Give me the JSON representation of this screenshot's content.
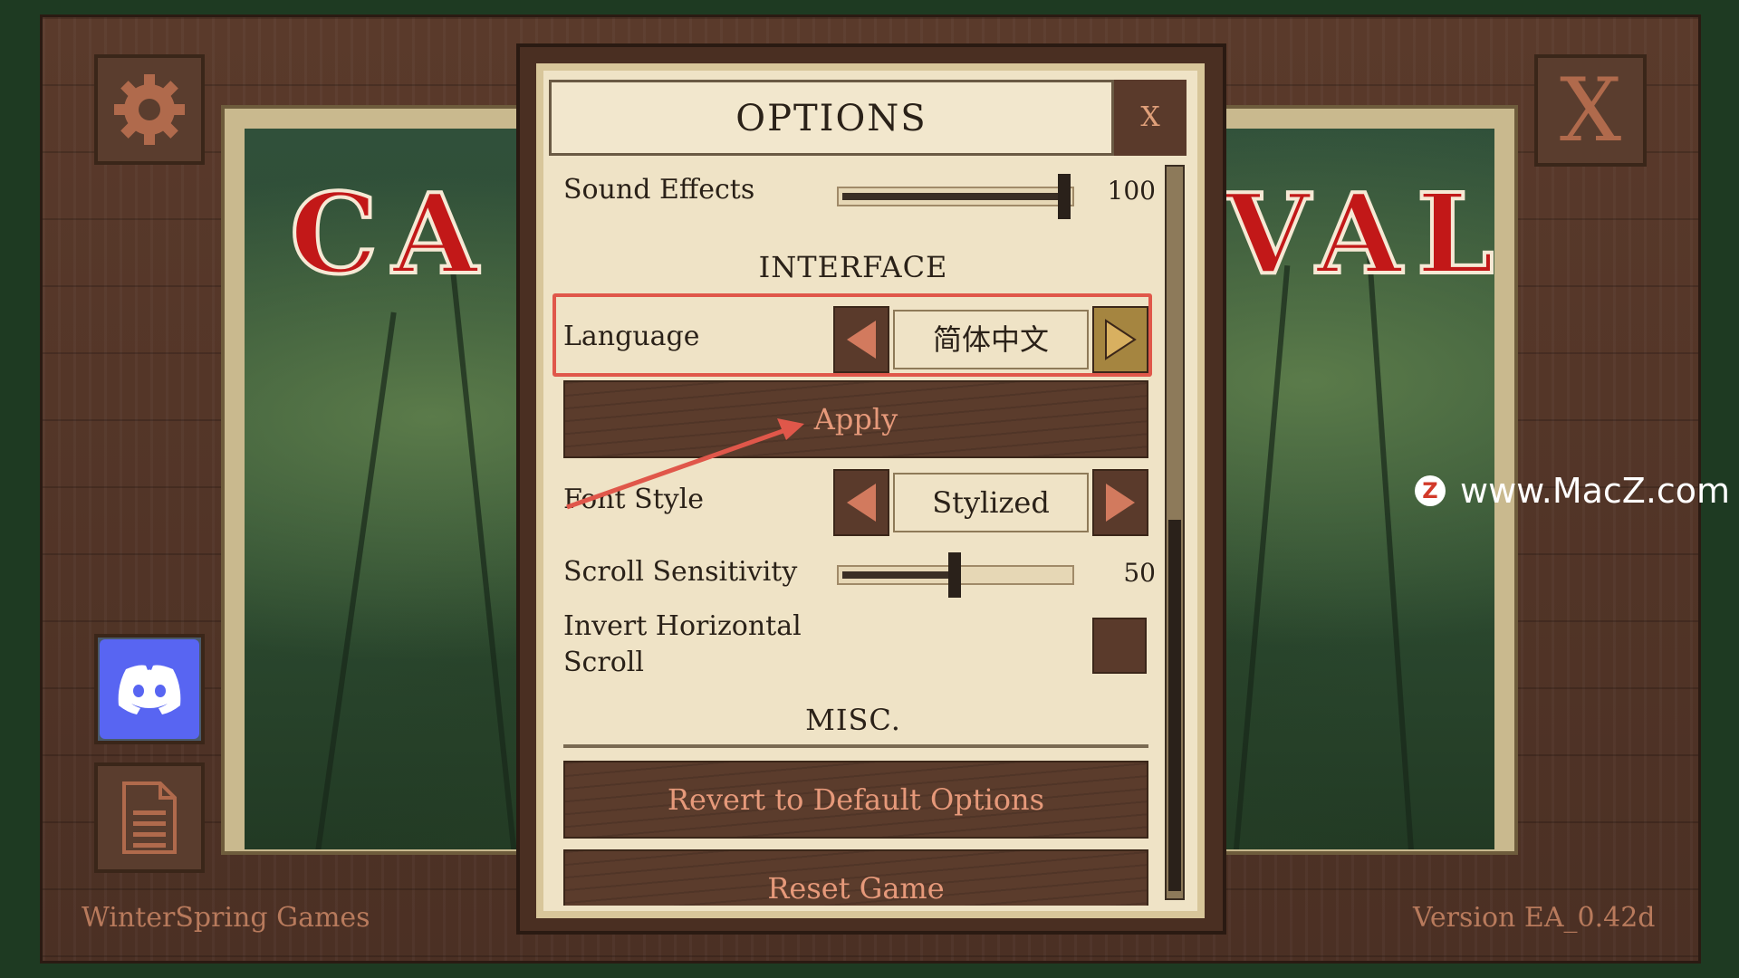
{
  "game": {
    "title_left": "CA",
    "title_right": "VAL",
    "footer_left": "WinterSpring Games",
    "footer_right": "Version EA_0.42d",
    "corner_close_label": "X"
  },
  "options": {
    "title": "OPTIONS",
    "close_label": "X",
    "sound_effects": {
      "label": "Sound Effects",
      "value": "100",
      "level": 1.0
    },
    "interface_header": "INTERFACE",
    "language": {
      "label": "Language",
      "value": "简体中文"
    },
    "apply_label": "Apply",
    "font_style": {
      "label": "Font Style",
      "value": "Stylized"
    },
    "scroll_sensitivity": {
      "label": "Scroll Sensitivity",
      "value": "50",
      "level": 0.5
    },
    "invert_horizontal_scroll": {
      "label_line1": "Invert Horizontal",
      "label_line2": "Scroll",
      "checked": false
    },
    "misc_header": "MISC.",
    "revert_label": "Revert to Default Options",
    "reset_label": "Reset Game"
  },
  "watermark": {
    "logo_letter": "Z",
    "text": "www.MacZ.com"
  },
  "colors": {
    "title_red": "#c21818",
    "wood": "#5a3a2b",
    "parchment": "#efe3c6",
    "button_text": "#e6997a",
    "highlight": "#e0574a",
    "discord": "#5865f2"
  },
  "icons": [
    "gear-icon",
    "discord-icon",
    "document-icon",
    "close-icon",
    "arrow-left-icon",
    "arrow-right-icon"
  ]
}
